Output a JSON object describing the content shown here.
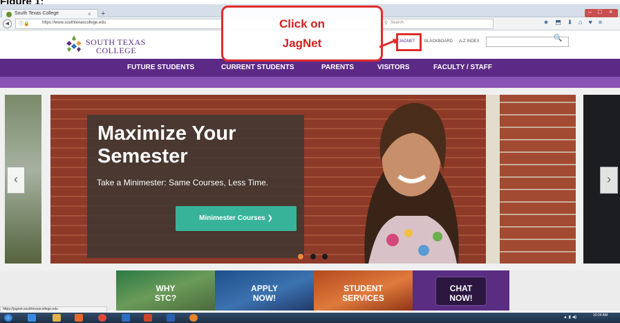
{
  "figure": {
    "title": "Figure 1:"
  },
  "browser": {
    "tab_title": "South Texas College",
    "tab_close": "×",
    "new_tab": "+",
    "url": "https://www.southtexascollege.edu",
    "search_placeholder": "Search",
    "reload": "C"
  },
  "site": {
    "logo_line1": "SOUTH TEXAS",
    "logo_line2": "COLLEGE",
    "top_links": {
      "jagnet": "JAGNET",
      "blackboard": "BLACKBOARD",
      "az_index": "A-Z INDEX"
    },
    "nav": [
      "FUTURE STUDENTS",
      "CURRENT STUDENTS",
      "PARENTS",
      "VISITORS",
      "FACULTY / STAFF"
    ]
  },
  "annotation": {
    "line1": "Click on",
    "line2": "JagNet"
  },
  "hero": {
    "title_line1": "Maximize Your",
    "title_line2": "Semester",
    "subtitle": "Take a Minimester: Same Courses, Less Time.",
    "button": "Minimester Courses ❯",
    "prev": "‹",
    "next": "›",
    "active_slide": 1,
    "slide_count": 3
  },
  "tiles": [
    {
      "line1": "WHY",
      "line2": "STC?"
    },
    {
      "line1": "APPLY",
      "line2": "NOW!"
    },
    {
      "line1": "STUDENT",
      "line2": "SERVICES"
    },
    {
      "line1": "CHAT",
      "line2": "NOW!"
    }
  ],
  "status_bar": {
    "url": "https://jagnet.southtexascollege.edu"
  },
  "taskbar": {
    "clock": "10:24 AM"
  },
  "colors": {
    "brand_purple": "#5c2a86",
    "accent_teal": "#37b39a",
    "annotation_red": "#e02b2b"
  }
}
